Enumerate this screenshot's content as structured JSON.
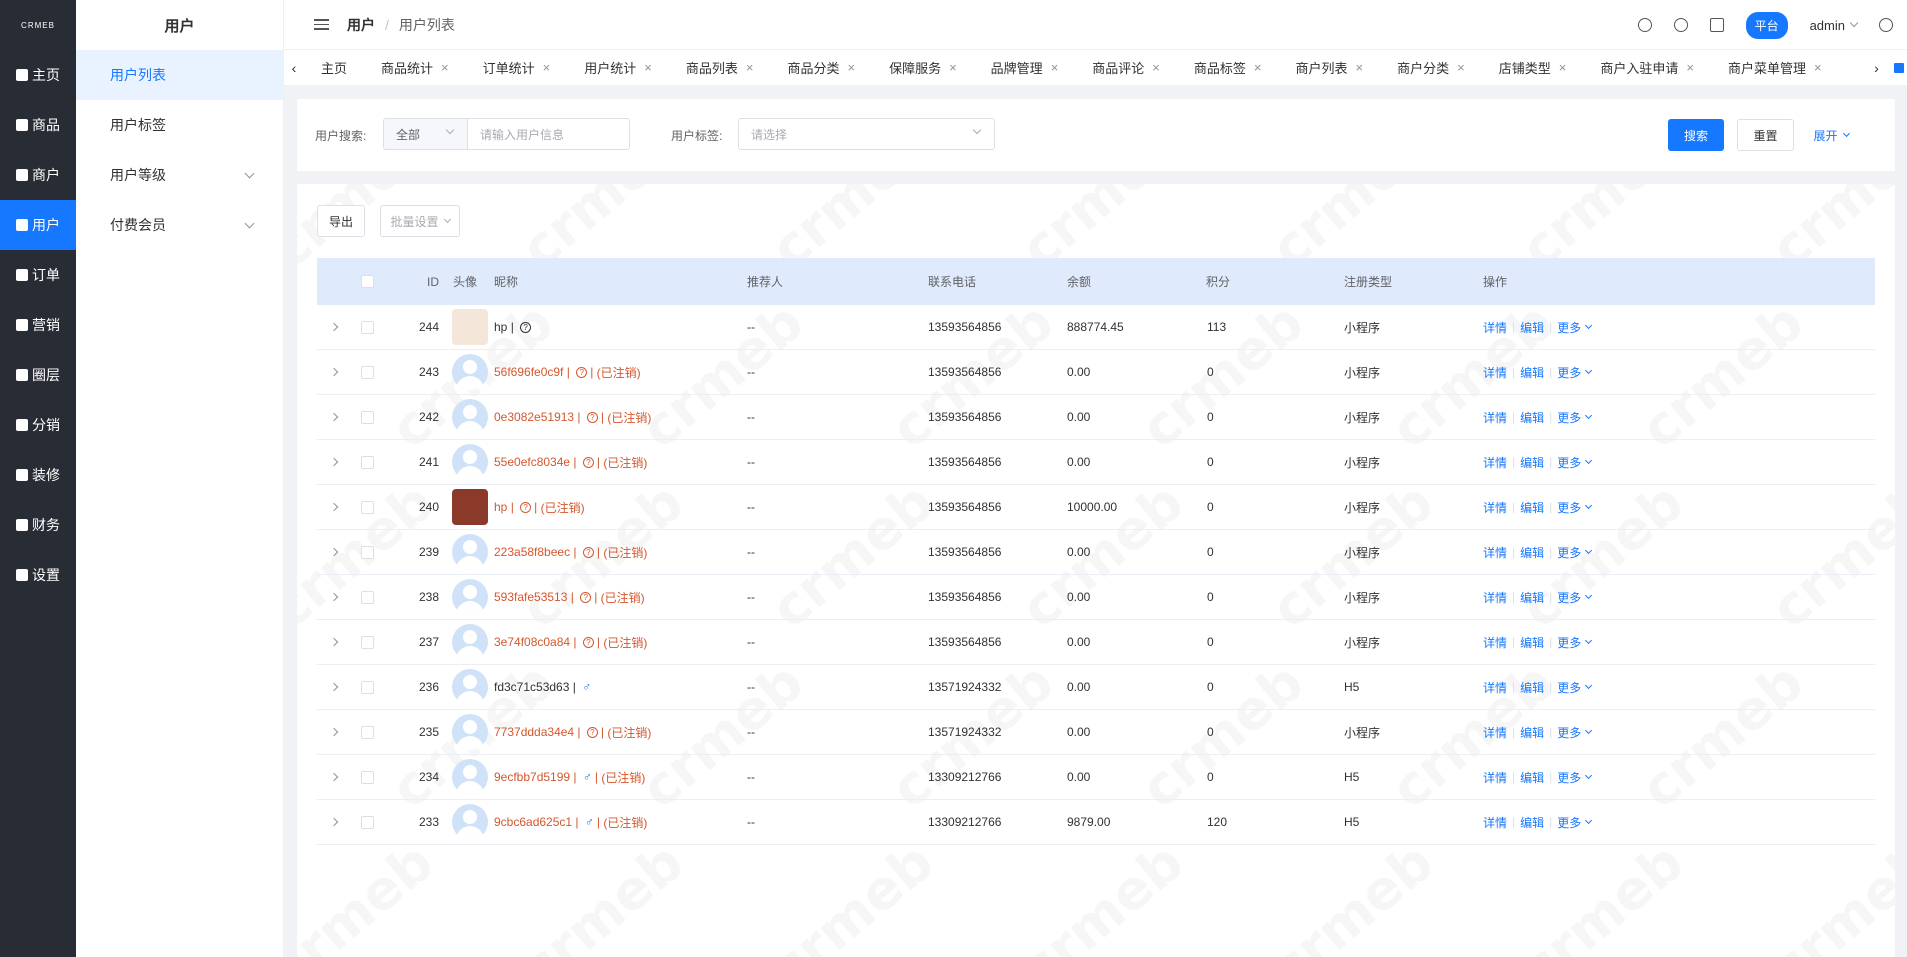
{
  "sidebar": {
    "logo": "CRMEB",
    "items": [
      {
        "label": "主页",
        "icon": "home-icon"
      },
      {
        "label": "商品",
        "icon": "bag-icon"
      },
      {
        "label": "商户",
        "icon": "store-icon"
      },
      {
        "label": "用户",
        "icon": "user-icon",
        "active": true
      },
      {
        "label": "订单",
        "icon": "order-icon"
      },
      {
        "label": "营销",
        "icon": "marketing-icon"
      },
      {
        "label": "圈层",
        "icon": "flag-icon"
      },
      {
        "label": "分销",
        "icon": "distribution-icon"
      },
      {
        "label": "装修",
        "icon": "decorate-icon"
      },
      {
        "label": "财务",
        "icon": "finance-icon"
      },
      {
        "label": "设置",
        "icon": "gear-icon"
      }
    ]
  },
  "submenu": {
    "title": "用户",
    "items": [
      {
        "label": "用户列表",
        "active": true
      },
      {
        "label": "用户标签"
      },
      {
        "label": "用户等级",
        "expandable": true
      },
      {
        "label": "付费会员",
        "expandable": true
      }
    ]
  },
  "header": {
    "breadcrumb": [
      "用户",
      "用户列表"
    ],
    "platform": "平台",
    "user": "admin"
  },
  "tabs": [
    "主页",
    "商品统计",
    "订单统计",
    "用户统计",
    "商品列表",
    "商品分类",
    "保障服务",
    "品牌管理",
    "商品评论",
    "商品标签",
    "商户列表",
    "商户分类",
    "店铺类型",
    "商户入驻申请",
    "商户菜单管理"
  ],
  "search": {
    "user_search_label": "用户搜索:",
    "search_type": "全部",
    "search_placeholder": "请输入用户信息",
    "tag_label": "用户标签:",
    "tag_placeholder": "请选择",
    "search_btn": "搜索",
    "reset_btn": "重置",
    "expand_btn": "展开"
  },
  "toolbar": {
    "export": "导出",
    "batch": "批量设置"
  },
  "table": {
    "columns": {
      "id": "ID",
      "avatar": "头像",
      "nickname": "昵称",
      "referrer": "推荐人",
      "phone": "联系电话",
      "balance": "余额",
      "points": "积分",
      "register_type": "注册类型",
      "actions": "操作"
    },
    "actions": {
      "detail": "详情",
      "edit": "编辑",
      "more": "更多"
    },
    "rows": [
      {
        "id": "244",
        "avatar": "photo1",
        "name": "hp",
        "marker": "?",
        "cancelled": false,
        "referrer": "--",
        "phone": "13593564856",
        "balance": "888774.45",
        "points": "113",
        "type": "小程序"
      },
      {
        "id": "243",
        "avatar": "default",
        "name": "56f696fe0c9f",
        "marker": "?",
        "cancelled": true,
        "referrer": "--",
        "phone": "13593564856",
        "balance": "0.00",
        "points": "0",
        "type": "小程序"
      },
      {
        "id": "242",
        "avatar": "default",
        "name": "0e3082e51913",
        "marker": "?",
        "cancelled": true,
        "referrer": "--",
        "phone": "13593564856",
        "balance": "0.00",
        "points": "0",
        "type": "小程序"
      },
      {
        "id": "241",
        "avatar": "default",
        "name": "55e0efc8034e",
        "marker": "?",
        "cancelled": true,
        "referrer": "--",
        "phone": "13593564856",
        "balance": "0.00",
        "points": "0",
        "type": "小程序"
      },
      {
        "id": "240",
        "avatar": "photo2",
        "name": "hp",
        "marker": "?",
        "cancelled": true,
        "referrer": "--",
        "phone": "13593564856",
        "balance": "10000.00",
        "points": "0",
        "type": "小程序"
      },
      {
        "id": "239",
        "avatar": "default",
        "name": "223a58f8beec",
        "marker": "?",
        "cancelled": true,
        "referrer": "--",
        "phone": "13593564856",
        "balance": "0.00",
        "points": "0",
        "type": "小程序"
      },
      {
        "id": "238",
        "avatar": "default",
        "name": "593fafe53513",
        "marker": "?",
        "cancelled": true,
        "referrer": "--",
        "phone": "13593564856",
        "balance": "0.00",
        "points": "0",
        "type": "小程序"
      },
      {
        "id": "237",
        "avatar": "default",
        "name": "3e74f08c0a84",
        "marker": "?",
        "cancelled": true,
        "referrer": "--",
        "phone": "13593564856",
        "balance": "0.00",
        "points": "0",
        "type": "小程序"
      },
      {
        "id": "236",
        "avatar": "default",
        "name": "fd3c71c53d63",
        "marker": "♂",
        "cancelled": false,
        "referrer": "--",
        "phone": "13571924332",
        "balance": "0.00",
        "points": "0",
        "type": "H5"
      },
      {
        "id": "235",
        "avatar": "default",
        "name": "7737ddda34e4",
        "marker": "?",
        "cancelled": true,
        "referrer": "--",
        "phone": "13571924332",
        "balance": "0.00",
        "points": "0",
        "type": "小程序"
      },
      {
        "id": "234",
        "avatar": "default",
        "name": "9ecfbb7d5199",
        "marker": "♂",
        "cancelled": true,
        "referrer": "--",
        "phone": "13309212766",
        "balance": "0.00",
        "points": "0",
        "type": "H5"
      },
      {
        "id": "233",
        "avatar": "default",
        "name": "9cbc6ad625c1",
        "marker": "♂",
        "cancelled": true,
        "referrer": "--",
        "phone": "13309212766",
        "balance": "9879.00",
        "points": "120",
        "type": "H5"
      }
    ],
    "cancelled_text": "(已注销)"
  },
  "colors": {
    "primary": "#1677ff",
    "sidebar": "#282c34",
    "cancelled": "#d4572d",
    "header_row": "#dfeafd"
  }
}
